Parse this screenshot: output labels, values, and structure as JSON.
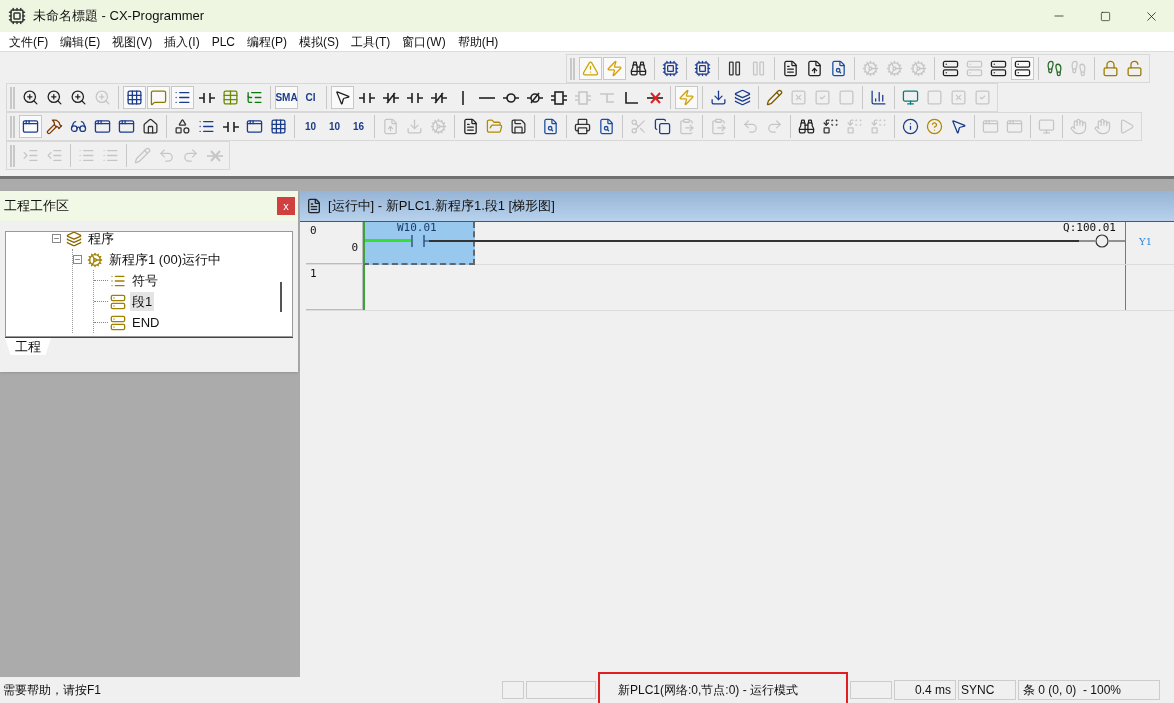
{
  "window": {
    "title": "未命名標題 - CX-Programmer"
  },
  "menu": [
    "文件(F)",
    "编辑(E)",
    "视图(V)",
    "插入(I)",
    "PLC",
    "编程(P)",
    "模拟(S)",
    "工具(T)",
    "窗口(W)",
    "帮助(H)"
  ],
  "toolbars": [
    {
      "groups": [
        [
          {
            "kind": "warning",
            "disabled": false,
            "active": true
          },
          {
            "kind": "zap",
            "disabled": false,
            "active": true
          },
          {
            "kind": "binoculars",
            "disabled": false,
            "active": false
          }
        ],
        [
          {
            "kind": "cpu",
            "disabled": false,
            "active": false
          }
        ],
        [
          {
            "kind": "cpu",
            "disabled": false,
            "active": false
          }
        ],
        [
          {
            "kind": "pause",
            "disabled": false,
            "active": false
          },
          {
            "kind": "pause",
            "disabled": true,
            "active": false
          }
        ],
        [
          {
            "kind": "file",
            "disabled": false,
            "active": false
          },
          {
            "kind": "upload",
            "disabled": false,
            "active": false
          },
          {
            "kind": "file-search",
            "disabled": false,
            "active": false
          }
        ],
        [
          {
            "kind": "cog",
            "disabled": true,
            "active": false
          },
          {
            "kind": "cog",
            "disabled": true,
            "active": false
          },
          {
            "kind": "cog",
            "disabled": true,
            "active": false
          }
        ],
        [
          {
            "kind": "module",
            "disabled": false,
            "active": false
          },
          {
            "kind": "module",
            "disabled": true,
            "active": false
          },
          {
            "kind": "module",
            "disabled": false,
            "active": false
          },
          {
            "kind": "module",
            "disabled": false,
            "active": true
          }
        ],
        [
          {
            "kind": "step",
            "disabled": false,
            "active": false
          },
          {
            "kind": "step",
            "disabled": true,
            "active": false
          }
        ],
        [
          {
            "kind": "lock",
            "disabled": false,
            "active": false
          },
          {
            "kind": "unlock",
            "disabled": false,
            "active": false
          }
        ]
      ]
    },
    {
      "groups": [
        [
          {
            "kind": "zoom",
            "disabled": false,
            "active": false
          },
          {
            "kind": "zoom",
            "disabled": false,
            "active": false
          },
          {
            "kind": "zoom",
            "disabled": false,
            "active": false
          },
          {
            "kind": "zoom",
            "disabled": true,
            "active": false
          }
        ],
        [
          {
            "kind": "grid",
            "disabled": false,
            "active": true
          },
          {
            "kind": "comment",
            "disabled": false,
            "active": true
          },
          {
            "kind": "list",
            "disabled": false,
            "active": true
          },
          {
            "kind": "contact",
            "disabled": false,
            "active": false
          },
          {
            "kind": "table",
            "disabled": false,
            "active": false
          },
          {
            "kind": "tree",
            "disabled": false,
            "active": false
          }
        ],
        [
          {
            "kind": "text",
            "label": "SMA",
            "disabled": false,
            "active": true
          },
          {
            "kind": "text",
            "label": "CI",
            "disabled": false,
            "active": false
          }
        ],
        [
          {
            "kind": "pointer",
            "disabled": false,
            "active": true
          },
          {
            "kind": "contact",
            "disabled": false,
            "active": false
          },
          {
            "kind": "contact-nc",
            "disabled": false,
            "active": false
          },
          {
            "kind": "contact",
            "disabled": false,
            "active": false
          },
          {
            "kind": "contact-nc",
            "disabled": false,
            "active": false
          },
          {
            "kind": "vline",
            "disabled": false,
            "active": false
          },
          {
            "kind": "hline",
            "disabled": false,
            "active": false
          },
          {
            "kind": "coil",
            "disabled": false,
            "active": false
          },
          {
            "kind": "coil-nc",
            "disabled": false,
            "active": false
          },
          {
            "kind": "block",
            "disabled": false,
            "active": false
          },
          {
            "kind": "block",
            "disabled": true,
            "active": false
          },
          {
            "kind": "branch",
            "disabled": true,
            "active": false
          },
          {
            "kind": "corner",
            "disabled": false,
            "active": false
          },
          {
            "kind": "delete",
            "disabled": false,
            "active": false
          }
        ],
        [
          {
            "kind": "zap",
            "disabled": false,
            "active": true
          }
        ],
        [
          {
            "kind": "download",
            "disabled": false,
            "active": false
          },
          {
            "kind": "layers",
            "disabled": false,
            "active": false
          }
        ],
        [
          {
            "kind": "edit",
            "disabled": false,
            "active": false
          },
          {
            "kind": "square-x",
            "disabled": true,
            "active": false
          },
          {
            "kind": "square-check",
            "disabled": true,
            "active": false
          },
          {
            "kind": "square",
            "disabled": true,
            "active": false
          }
        ],
        [
          {
            "kind": "bars",
            "disabled": false,
            "active": false
          }
        ],
        [
          {
            "kind": "monitor",
            "disabled": false,
            "active": false
          },
          {
            "kind": "square",
            "disabled": true,
            "active": false
          },
          {
            "kind": "square-x",
            "disabled": true,
            "active": false
          },
          {
            "kind": "square-check",
            "disabled": true,
            "active": false
          }
        ]
      ]
    },
    {
      "groups": [
        [
          {
            "kind": "window",
            "disabled": false,
            "active": true
          },
          {
            "kind": "hammer",
            "disabled": false,
            "active": false
          },
          {
            "kind": "glasses",
            "disabled": false,
            "active": false
          },
          {
            "kind": "window",
            "disabled": false,
            "active": false
          },
          {
            "kind": "window",
            "disabled": false,
            "active": false
          },
          {
            "kind": "home",
            "disabled": false,
            "active": false
          }
        ],
        [
          {
            "kind": "shapes",
            "disabled": false,
            "active": false
          },
          {
            "kind": "list",
            "disabled": false,
            "active": false
          },
          {
            "kind": "contact",
            "disabled": false,
            "active": false
          },
          {
            "kind": "window",
            "disabled": false,
            "active": false
          },
          {
            "kind": "grid",
            "disabled": false,
            "active": false
          }
        ],
        [
          {
            "kind": "text",
            "label": "10",
            "disabled": false,
            "active": false
          },
          {
            "kind": "text",
            "label": "10",
            "disabled": false,
            "active": false
          },
          {
            "kind": "text",
            "label": "16",
            "disabled": false,
            "active": false
          }
        ],
        [
          {
            "kind": "upload",
            "disabled": true,
            "active": false
          },
          {
            "kind": "download",
            "disabled": true,
            "active": false
          },
          {
            "kind": "cog",
            "disabled": true,
            "active": false
          }
        ],
        [
          {
            "kind": "file",
            "disabled": false,
            "active": false
          },
          {
            "kind": "folder",
            "disabled": false,
            "active": false
          },
          {
            "kind": "save",
            "disabled": false,
            "active": false
          }
        ],
        [
          {
            "kind": "file-search",
            "disabled": false,
            "active": false
          }
        ],
        [
          {
            "kind": "printer",
            "disabled": false,
            "active": false
          },
          {
            "kind": "file-search",
            "disabled": false,
            "active": false
          }
        ],
        [
          {
            "kind": "scissors",
            "disabled": true,
            "active": false
          },
          {
            "kind": "copy",
            "disabled": false,
            "active": false
          },
          {
            "kind": "paste",
            "disabled": true,
            "active": false
          }
        ],
        [
          {
            "kind": "paste",
            "disabled": true,
            "active": false
          }
        ],
        [
          {
            "kind": "undo",
            "disabled": true,
            "active": false
          },
          {
            "kind": "redo",
            "disabled": true,
            "active": false
          }
        ],
        [
          {
            "kind": "binoculars",
            "disabled": false,
            "active": false
          },
          {
            "kind": "replace",
            "disabled": false,
            "active": false
          },
          {
            "kind": "replace",
            "disabled": true,
            "active": false
          },
          {
            "kind": "replace",
            "disabled": true,
            "active": false
          }
        ],
        [
          {
            "kind": "info",
            "disabled": false,
            "active": false
          },
          {
            "kind": "help",
            "disabled": false,
            "active": false
          },
          {
            "kind": "pointer-help",
            "disabled": false,
            "active": false
          }
        ],
        [
          {
            "kind": "window",
            "disabled": true,
            "active": false
          },
          {
            "kind": "window",
            "disabled": true,
            "active": false
          }
        ],
        [
          {
            "kind": "monitor",
            "disabled": true,
            "active": false
          }
        ],
        [
          {
            "kind": "hand",
            "disabled": true,
            "active": false
          },
          {
            "kind": "hand",
            "disabled": true,
            "active": false
          },
          {
            "kind": "play",
            "disabled": true,
            "active": false
          }
        ]
      ]
    },
    {
      "groups": [
        [
          {
            "kind": "indent",
            "disabled": true,
            "active": false
          },
          {
            "kind": "outdent",
            "disabled": true,
            "active": false
          }
        ],
        [
          {
            "kind": "list",
            "disabled": true,
            "active": false
          },
          {
            "kind": "list",
            "disabled": true,
            "active": false
          }
        ],
        [
          {
            "kind": "edit",
            "disabled": true,
            "active": false
          },
          {
            "kind": "undo",
            "disabled": true,
            "active": false
          },
          {
            "kind": "redo",
            "disabled": true,
            "active": false
          },
          {
            "kind": "delete",
            "disabled": true,
            "active": false
          }
        ]
      ]
    }
  ],
  "workspace": {
    "title": "工程工作区",
    "close": "x",
    "tree": [
      {
        "label": "程序",
        "kind": "folder",
        "selected": false,
        "expanded": true,
        "children": [
          {
            "label": "新程序1 (00)运行中",
            "kind": "program",
            "selected": false,
            "expanded": true,
            "children": [
              {
                "label": "符号",
                "kind": "symbols",
                "selected": false
              },
              {
                "label": "段1",
                "kind": "section",
                "selected": true
              },
              {
                "label": "END",
                "kind": "section",
                "selected": false
              }
            ]
          }
        ]
      }
    ],
    "tabs": [
      {
        "label": "工程",
        "selected": true
      }
    ]
  },
  "ladder": {
    "title": "[运行中] - 新PLC1.新程序1.段1 [梯形图]",
    "rungs": [
      {
        "kind": "instruction",
        "number": "0",
        "step": "0",
        "contact": "W10.01",
        "energized": true,
        "selected": true,
        "coil": "Q:100.01",
        "coil_comment": "Y1"
      },
      {
        "kind": "empty",
        "number": "1"
      }
    ]
  },
  "status_bar": {
    "help": "需要帮助，请按F1",
    "plc": {
      "text": "新PLC1(网络:0,节点:0) - 运行模式",
      "highlighted": true
    },
    "cycle_time": "0.4 ms",
    "sync": "SYNC",
    "position": "条 0 (0, 0)  - 100%"
  }
}
